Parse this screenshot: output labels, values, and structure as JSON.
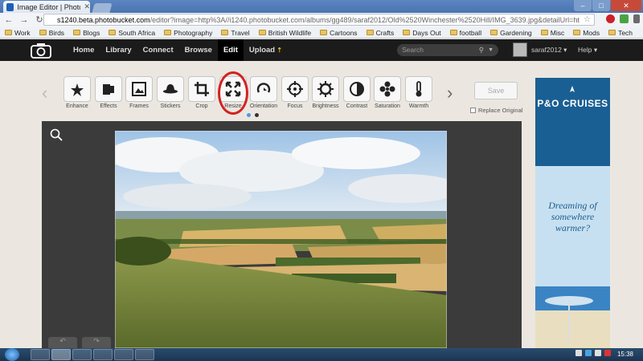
{
  "browser": {
    "tab_title": "Image Editor | Photobucke",
    "address_domain": "s1240.beta.photobucket.com",
    "address_rest": "/editor?image=http%3A//i1240.photobucket.com/albums/gg489/saraf2012/Old%2520Winchester%2520Hill/IMG_3639.jpg&detailUrl=ht",
    "bookmarks": [
      "Work",
      "Birds",
      "Blogs",
      "South Africa",
      "Photography",
      "Travel",
      "British Wildlife",
      "Cartoons",
      "Crafts",
      "Days Out",
      "football",
      "Gardening",
      "Misc",
      "Mods",
      "Tech"
    ]
  },
  "site": {
    "nav": [
      "Home",
      "Library",
      "Connect",
      "Browse",
      "Edit",
      "Upload"
    ],
    "active_nav": "Edit",
    "search_placeholder": "Search",
    "username": "saraf2012",
    "help_label": "Help"
  },
  "editor": {
    "tools": [
      {
        "label": "Enhance",
        "icon": "enhance-icon"
      },
      {
        "label": "Effects",
        "icon": "effects-icon"
      },
      {
        "label": "Frames",
        "icon": "frames-icon"
      },
      {
        "label": "Stickers",
        "icon": "stickers-icon"
      },
      {
        "label": "Crop",
        "icon": "crop-icon"
      },
      {
        "label": "Resize",
        "icon": "resize-icon"
      },
      {
        "label": "Orientation",
        "icon": "orientation-icon"
      },
      {
        "label": "Focus",
        "icon": "focus-icon"
      },
      {
        "label": "Brightness",
        "icon": "brightness-icon"
      },
      {
        "label": "Contrast",
        "icon": "contrast-icon"
      },
      {
        "label": "Saturation",
        "icon": "saturation-icon"
      },
      {
        "label": "Warmth",
        "icon": "warmth-icon"
      }
    ],
    "save_label": "Save",
    "replace_label": "Replace Original"
  },
  "ad": {
    "brand": "P&O CRUISES",
    "tagline": "Dreaming of somewhere warmer?"
  },
  "taskbar": {
    "clock": "15:38"
  },
  "colors": {
    "site_header": "#1b1b1b",
    "canvas": "#3b3b3b",
    "highlight": "#d42222",
    "upload_accent": "#f0c020"
  }
}
